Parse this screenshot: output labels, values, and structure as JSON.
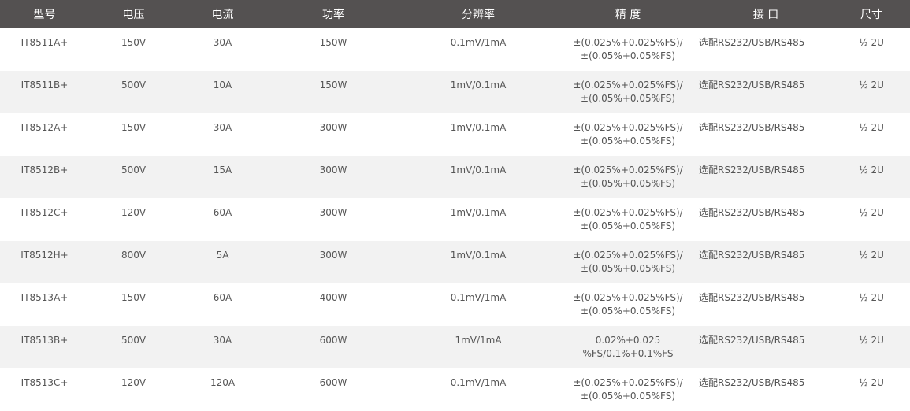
{
  "headers": {
    "model": "型号",
    "voltage": "电压",
    "current": "电流",
    "power": "功率",
    "resolution": "分辨率",
    "accuracy": "精 度",
    "interface": "接 口",
    "size": "尺寸"
  },
  "rows": [
    {
      "model": "IT8511A+",
      "voltage": "150V",
      "current": "30A",
      "power": "150W",
      "resolution": "0.1mV/1mA",
      "accuracy": "±(0.025%+0.025%FS)/\n±(0.05%+0.05%FS)",
      "interface": "选配RS232/USB/RS485",
      "size": "½ 2U"
    },
    {
      "model": "IT8511B+",
      "voltage": "500V",
      "current": "10A",
      "power": "150W",
      "resolution": "1mV/0.1mA",
      "accuracy": "±(0.025%+0.025%FS)/\n±(0.05%+0.05%FS)",
      "interface": "选配RS232/USB/RS485",
      "size": "½ 2U"
    },
    {
      "model": "IT8512A+",
      "voltage": "150V",
      "current": "30A",
      "power": "300W",
      "resolution": "1mV/0.1mA",
      "accuracy": "±(0.025%+0.025%FS)/\n±(0.05%+0.05%FS)",
      "interface": "选配RS232/USB/RS485",
      "size": "½ 2U"
    },
    {
      "model": "IT8512B+",
      "voltage": "500V",
      "current": "15A",
      "power": "300W",
      "resolution": "1mV/0.1mA",
      "accuracy": "±(0.025%+0.025%FS)/\n±(0.05%+0.05%FS)",
      "interface": "选配RS232/USB/RS485",
      "size": "½ 2U"
    },
    {
      "model": "IT8512C+",
      "voltage": "120V",
      "current": "60A",
      "power": "300W",
      "resolution": "1mV/0.1mA",
      "accuracy": "±(0.025%+0.025%FS)/\n±(0.05%+0.05%FS)",
      "interface": "选配RS232/USB/RS485",
      "size": "½ 2U"
    },
    {
      "model": "IT8512H+",
      "voltage": "800V",
      "current": "5A",
      "power": "300W",
      "resolution": "1mV/0.1mA",
      "accuracy": "±(0.025%+0.025%FS)/\n±(0.05%+0.05%FS)",
      "interface": "选配RS232/USB/RS485",
      "size": "½ 2U"
    },
    {
      "model": "IT8513A+",
      "voltage": "150V",
      "current": "60A",
      "power": "400W",
      "resolution": "0.1mV/1mA",
      "accuracy": "±(0.025%+0.025%FS)/\n±(0.05%+0.05%FS)",
      "interface": "选配RS232/USB/RS485",
      "size": "½ 2U"
    },
    {
      "model": "IT8513B+",
      "voltage": "500V",
      "current": "30A",
      "power": "600W",
      "resolution": "1mV/1mA",
      "accuracy": "0.02%+0.025\n%FS/0.1%+0.1%FS",
      "interface": "选配RS232/USB/RS485",
      "size": "½ 2U"
    },
    {
      "model": "IT8513C+",
      "voltage": "120V",
      "current": "120A",
      "power": "600W",
      "resolution": "0.1mV/1mA",
      "accuracy": "±(0.025%+0.025%FS)/\n±(0.05%+0.05%FS)",
      "interface": "选配RS232/USB/RS485",
      "size": "½ 2U"
    }
  ],
  "colors": {
    "header_bg": "#545151",
    "header_text": "#ffffff",
    "row_alt_bg": "#f2f2f2",
    "cell_text": "#555555"
  }
}
